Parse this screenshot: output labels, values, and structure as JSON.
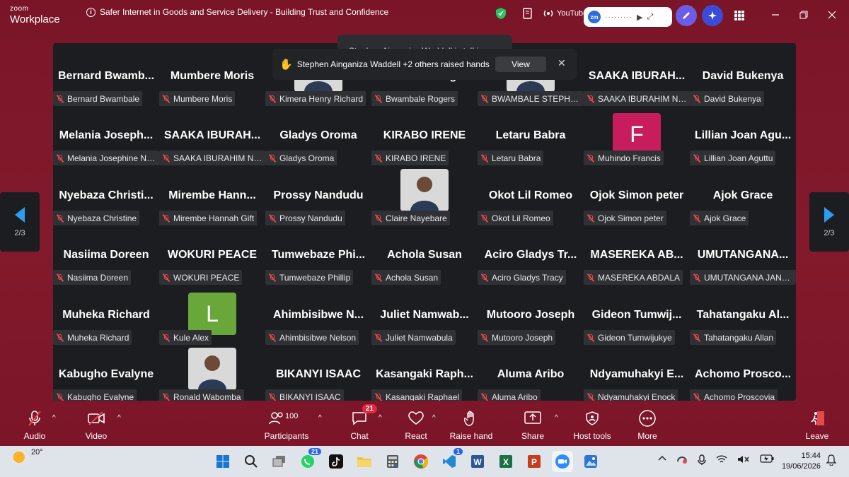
{
  "app": {
    "logo_line1": "zoom",
    "logo_line2": "Workplace",
    "meeting_title": "Safer Internet in Goods and Service Delivery - Building Trust and Confidence",
    "youtube_label": "YouTube",
    "zm_label": "zm"
  },
  "toasts": {
    "talking": "Stephen Ainganiza Waddell is talking...",
    "raised": "Stephen Ainganiza Waddell +2 others raised hands",
    "view_label": "View",
    "close": "✕"
  },
  "pager": {
    "left": "2/3",
    "right": "2/3"
  },
  "participants": [
    {
      "big": "Bernard  Bwamb...",
      "name": "Bernard Bwambale"
    },
    {
      "big": "Mumbere Moris",
      "name": "Mumbere Moris"
    },
    {
      "big": "",
      "name": "Kimera Henry Richard",
      "photo": true
    },
    {
      "big": "Bwambale Rogers",
      "name": "Bwambale Rogers"
    },
    {
      "big": "",
      "name": "BWAMBALE STEPHEN",
      "photo": true
    },
    {
      "big": "SAAKA  IBURAH...",
      "name": "SAAKA IBURAHIM NAT..."
    },
    {
      "big": "David Bukenya",
      "name": "David Bukenya"
    },
    {
      "big": "Melania  Joseph...",
      "name": "Melania Josephine Nn..."
    },
    {
      "big": "SAAKA  IBURAH...",
      "name": "SAAKA IBURAHIM NAT..."
    },
    {
      "big": "Gladys Oroma",
      "name": "Gladys Oroma"
    },
    {
      "big": "KIRABO IRENE",
      "name": "KIRABO IRENE"
    },
    {
      "big": "Letaru Babra",
      "name": "Letaru Babra"
    },
    {
      "big": "",
      "name": "Muhindo Francis",
      "avatar": "F",
      "avatar_color": "#c81d5c"
    },
    {
      "big": "Lillian Joan  Agu...",
      "name": "Lillian Joan Aguttu"
    },
    {
      "big": "Nyebaza  Christi...",
      "name": "Nyebaza Christine"
    },
    {
      "big": "Mirembe  Hann...",
      "name": "Mirembe Hannah Gift"
    },
    {
      "big": "Prossy Nandudu",
      "name": "Prossy Nandudu"
    },
    {
      "big": "",
      "name": "Claire Nayebare",
      "photo": true
    },
    {
      "big": "Okot Lil Romeo",
      "name": "Okot Lil Romeo"
    },
    {
      "big": "Ojok Simon peter",
      "name": "Ojok Simon peter"
    },
    {
      "big": "Ajok Grace",
      "name": "Ajok Grace"
    },
    {
      "big": "Nasiima Doreen",
      "name": "Nasiima Doreen"
    },
    {
      "big": "WOKURI PEACE",
      "name": "WOKURI PEACE"
    },
    {
      "big": "Tumwebaze  Phi...",
      "name": "Tumwebaze Phillip"
    },
    {
      "big": "Achola Susan",
      "name": "Achola Susan"
    },
    {
      "big": "Aciro  Gladys  Tr...",
      "name": "Aciro Gladys Tracy"
    },
    {
      "big": "MASEREKA  AB...",
      "name": "MASEREKA ABDALA"
    },
    {
      "big": "UMUTANGANA...",
      "name": "UMUTANGANA JANE ..."
    },
    {
      "big": "Muheka Richard",
      "name": "Muheka Richard"
    },
    {
      "big": "",
      "name": "Kule Alex",
      "avatar": "L",
      "avatar_color": "#6aa73a"
    },
    {
      "big": "Ahimbisibwe  N...",
      "name": "Ahimbisibwe Nelson"
    },
    {
      "big": "Juliet  Namwab...",
      "name": "Juliet Namwabula"
    },
    {
      "big": "Mutooro Joseph",
      "name": "Mutooro Joseph"
    },
    {
      "big": "Gideon  Tumwij...",
      "name": "Gideon Tumwijukye"
    },
    {
      "big": "Tahatangaku  Al...",
      "name": "Tahatangaku Allan"
    },
    {
      "big": "Kabugho Evalyne",
      "name": "Kabugho Evalyne"
    },
    {
      "big": "",
      "name": "Ronald Wabomba",
      "photo": true
    },
    {
      "big": "BIKANYI ISAAC",
      "name": "BIKANYI ISAAC"
    },
    {
      "big": "Kasangaki  Raph...",
      "name": "Kasangaki Raphael"
    },
    {
      "big": "Aluma Aribo",
      "name": "Aluma Aribo"
    },
    {
      "big": "Ndyamuhakyi  E...",
      "name": "Ndyamuhakyi Enock"
    },
    {
      "big": "Achomo  Prosco...",
      "name": "Achomo Proscovia"
    }
  ],
  "toolbar": {
    "audio": "Audio",
    "video": "Video",
    "participants": "Participants",
    "participants_count": "100",
    "chat": "Chat",
    "chat_badge": "21",
    "react": "React",
    "raise_hand": "Raise hand",
    "share": "Share",
    "host_tools": "Host tools",
    "more": "More",
    "leave": "Leave"
  },
  "taskbar": {
    "temperature": "20°",
    "whatsapp_badge": "21",
    "vscode_badge": "1",
    "time": "15:44",
    "date": "19/06/2026"
  }
}
